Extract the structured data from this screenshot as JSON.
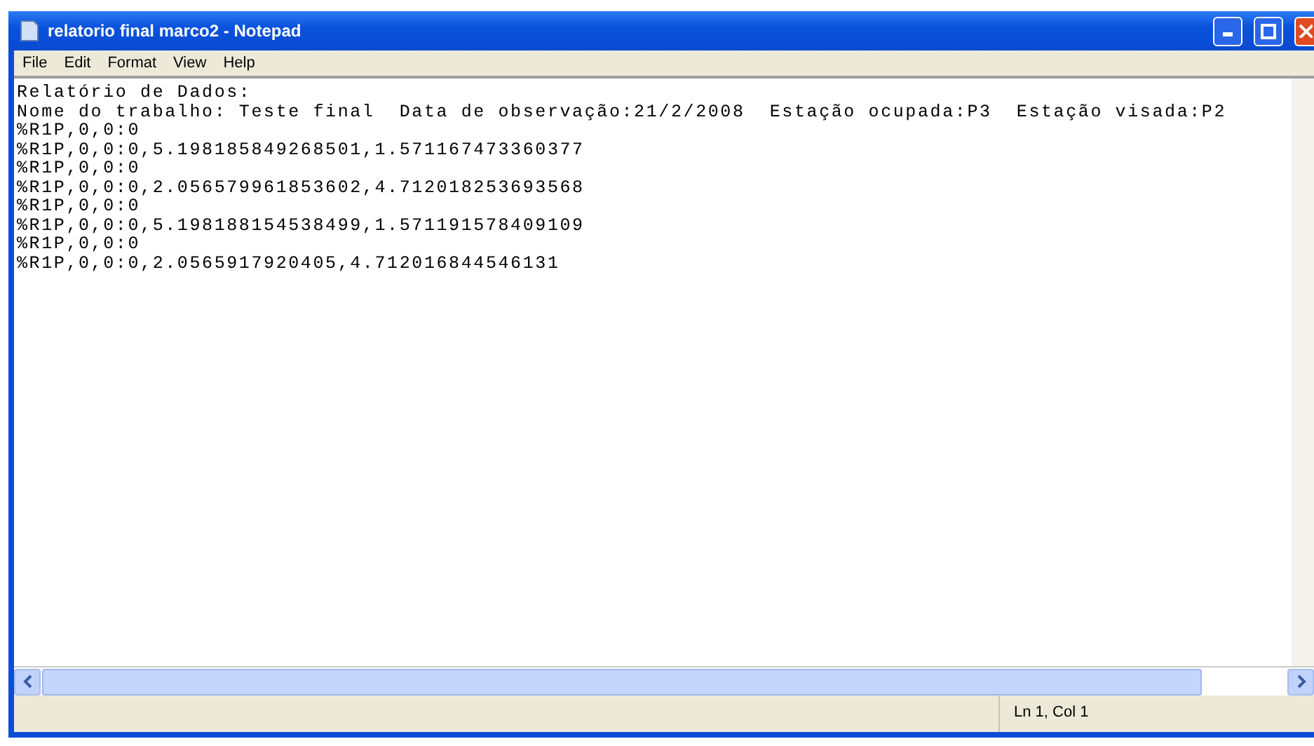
{
  "window": {
    "title": "relatorio final marco2 - Notepad"
  },
  "menu": [
    "File",
    "Edit",
    "Format",
    "View",
    "Help"
  ],
  "text_lines": [
    "Relatório de Dados:",
    "Nome do trabalho: Teste final  Data de observação:21/2/2008  Estação ocupada:P3  Estação visada:P2",
    "%R1P,0,0:0",
    "%R1P,0,0:0,5.198185849268501,1.571167473360377",
    "%R1P,0,0:0",
    "%R1P,0,0:0,2.056579961853602,4.712018253693568",
    "%R1P,0,0:0",
    "%R1P,0,0:0,5.198188154538499,1.571191578409109",
    "%R1P,0,0:0",
    "%R1P,0,0:0,2.0565917920405,4.712016844546131"
  ],
  "status_bar": {
    "position": "Ln 1, Col 1"
  }
}
